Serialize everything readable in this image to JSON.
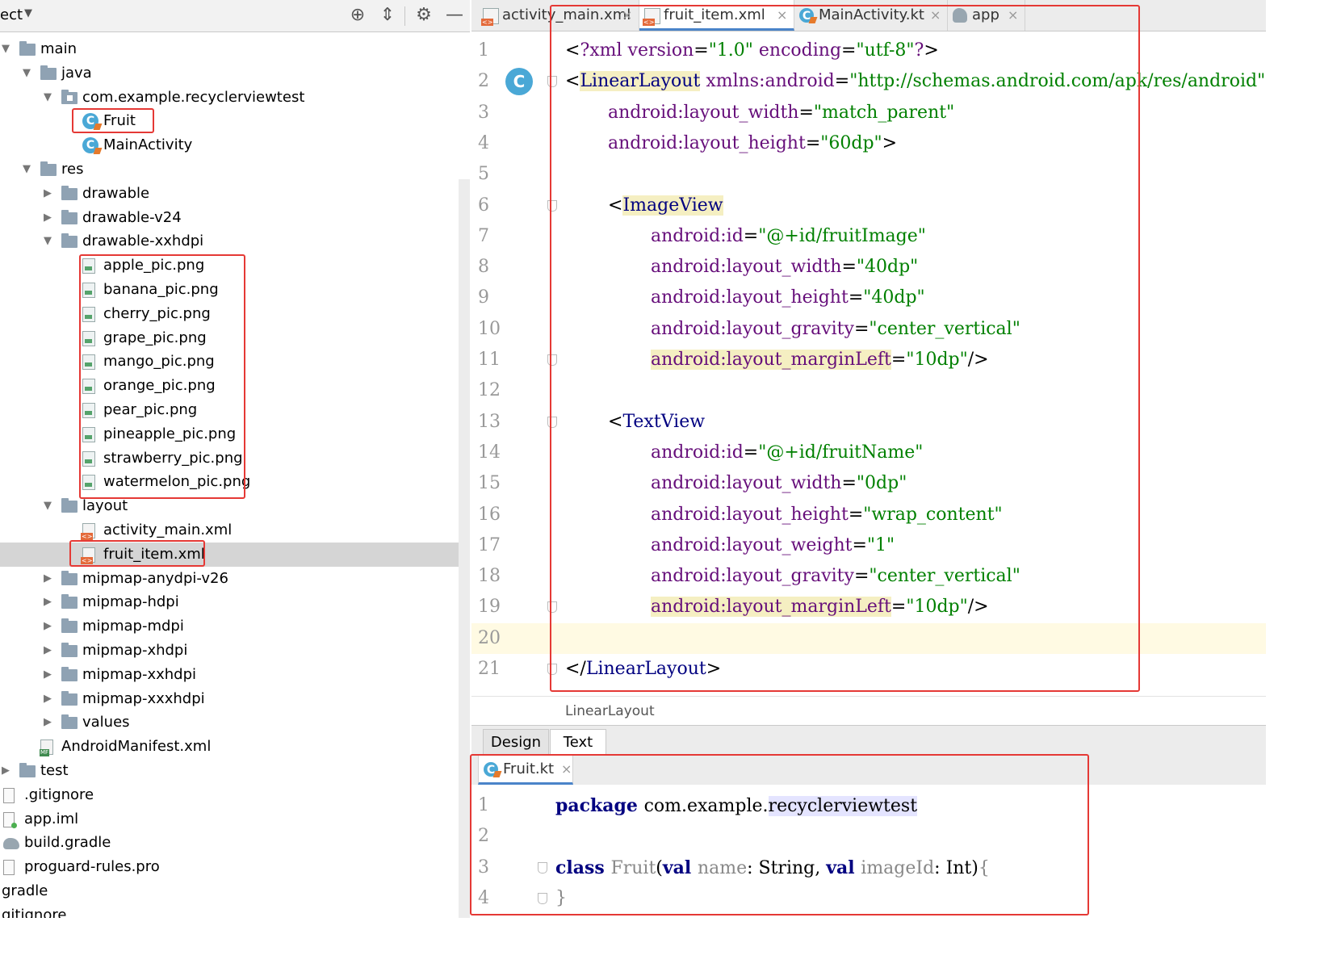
{
  "project_panel": {
    "title": "ect",
    "items": [
      {
        "label": "main",
        "type": "folder",
        "arrow": "down",
        "indent": 0
      },
      {
        "label": "java",
        "type": "folder",
        "arrow": "down",
        "indent": 1
      },
      {
        "label": "com.example.recyclerviewtest",
        "type": "package",
        "arrow": "down",
        "indent": 2
      },
      {
        "label": "Fruit",
        "type": "class",
        "arrow": "",
        "indent": 3
      },
      {
        "label": "MainActivity",
        "type": "class",
        "arrow": "",
        "indent": 3
      },
      {
        "label": "res",
        "type": "folder",
        "arrow": "down",
        "indent": 1
      },
      {
        "label": "drawable",
        "type": "folder",
        "arrow": "right",
        "indent": 2
      },
      {
        "label": "drawable-v24",
        "type": "folder",
        "arrow": "right",
        "indent": 2
      },
      {
        "label": "drawable-xxhdpi",
        "type": "folder",
        "arrow": "down",
        "indent": 2
      },
      {
        "label": "apple_pic.png",
        "type": "image",
        "arrow": "",
        "indent": 3
      },
      {
        "label": "banana_pic.png",
        "type": "image",
        "arrow": "",
        "indent": 3
      },
      {
        "label": "cherry_pic.png",
        "type": "image",
        "arrow": "",
        "indent": 3
      },
      {
        "label": "grape_pic.png",
        "type": "image",
        "arrow": "",
        "indent": 3
      },
      {
        "label": "mango_pic.png",
        "type": "image",
        "arrow": "",
        "indent": 3
      },
      {
        "label": "orange_pic.png",
        "type": "image",
        "arrow": "",
        "indent": 3
      },
      {
        "label": "pear_pic.png",
        "type": "image",
        "arrow": "",
        "indent": 3
      },
      {
        "label": "pineapple_pic.png",
        "type": "image",
        "arrow": "",
        "indent": 3
      },
      {
        "label": "strawberry_pic.png",
        "type": "image",
        "arrow": "",
        "indent": 3
      },
      {
        "label": "watermelon_pic.png",
        "type": "image",
        "arrow": "",
        "indent": 3
      },
      {
        "label": "layout",
        "type": "folder",
        "arrow": "down",
        "indent": 2
      },
      {
        "label": "activity_main.xml",
        "type": "xml",
        "arrow": "",
        "indent": 3
      },
      {
        "label": "fruit_item.xml",
        "type": "xml",
        "arrow": "",
        "indent": 3,
        "selected": true
      },
      {
        "label": "mipmap-anydpi-v26",
        "type": "folder",
        "arrow": "right",
        "indent": 2
      },
      {
        "label": "mipmap-hdpi",
        "type": "folder",
        "arrow": "right",
        "indent": 2
      },
      {
        "label": "mipmap-mdpi",
        "type": "folder",
        "arrow": "right",
        "indent": 2
      },
      {
        "label": "mipmap-xhdpi",
        "type": "folder",
        "arrow": "right",
        "indent": 2
      },
      {
        "label": "mipmap-xxhdpi",
        "type": "folder",
        "arrow": "right",
        "indent": 2
      },
      {
        "label": "mipmap-xxxhdpi",
        "type": "folder",
        "arrow": "right",
        "indent": 2
      },
      {
        "label": "values",
        "type": "folder",
        "arrow": "right",
        "indent": 2
      },
      {
        "label": "AndroidManifest.xml",
        "type": "manifest",
        "arrow": "",
        "indent": 1
      },
      {
        "label": "test",
        "type": "folder",
        "arrow": "right",
        "indent": 0
      },
      {
        "label": ".gitignore",
        "type": "text",
        "arrow": "",
        "indent": -1
      },
      {
        "label": "app.iml",
        "type": "iml",
        "arrow": "",
        "indent": -1
      },
      {
        "label": "build.gradle",
        "type": "gradle",
        "arrow": "",
        "indent": -1
      },
      {
        "label": "proguard-rules.pro",
        "type": "text",
        "arrow": "",
        "indent": -1
      },
      {
        "label": "gradle",
        "type": "none",
        "arrow": "",
        "indent": -2
      },
      {
        "label": "gitignore",
        "type": "none",
        "arrow": "",
        "indent": -2
      }
    ]
  },
  "editor_tabs": [
    {
      "label": "activity_main.xml",
      "icon": "xml-file-icon",
      "active": false
    },
    {
      "label": "fruit_item.xml",
      "icon": "xml-file-icon",
      "active": true
    },
    {
      "label": "MainActivity.kt",
      "icon": "kotlin-class-icon",
      "active": false
    },
    {
      "label": "app",
      "icon": "gradle-icon",
      "active": false
    }
  ],
  "close_glyph": "×",
  "gutter_badge": "C",
  "xml_lines": [
    {
      "n": "1",
      "indent": 0,
      "fold": false,
      "tokens": [
        [
          "pun",
          "<"
        ],
        [
          "attr",
          "?xml "
        ],
        [
          "attr",
          "version"
        ],
        [
          "pun",
          "="
        ],
        [
          "str",
          "\"1.0\" "
        ],
        [
          "attr",
          "encoding"
        ],
        [
          "pun",
          "="
        ],
        [
          "str",
          "\"utf-8\""
        ],
        [
          "attr",
          "?"
        ],
        [
          "pun",
          ">"
        ]
      ]
    },
    {
      "n": "2",
      "indent": 0,
      "fold": true,
      "tokens": [
        [
          "pun",
          "<"
        ],
        [
          "tag hl",
          "LinearLayout"
        ],
        [
          "pun",
          " "
        ],
        [
          "attr",
          "xmlns:android"
        ],
        [
          "pun",
          "="
        ],
        [
          "str",
          "\"http://schemas.android.com/apk/res/android\""
        ]
      ]
    },
    {
      "n": "3",
      "indent": 1,
      "fold": false,
      "tokens": [
        [
          "attr",
          "android:layout_width"
        ],
        [
          "pun",
          "="
        ],
        [
          "str",
          "\"match_parent\""
        ]
      ]
    },
    {
      "n": "4",
      "indent": 1,
      "fold": false,
      "tokens": [
        [
          "attr",
          "android:layout_height"
        ],
        [
          "pun",
          "="
        ],
        [
          "str",
          "\"60dp\""
        ],
        [
          "pun",
          ">"
        ]
      ]
    },
    {
      "n": "5",
      "indent": 0,
      "fold": false,
      "tokens": []
    },
    {
      "n": "6",
      "indent": 1,
      "fold": true,
      "tokens": [
        [
          "pun",
          "<"
        ],
        [
          "tag hl",
          "ImageView"
        ]
      ]
    },
    {
      "n": "7",
      "indent": 2,
      "fold": false,
      "tokens": [
        [
          "attr",
          "android:id"
        ],
        [
          "pun",
          "="
        ],
        [
          "str",
          "\"@+id/fruitImage\""
        ]
      ]
    },
    {
      "n": "8",
      "indent": 2,
      "fold": false,
      "tokens": [
        [
          "attr",
          "android:layout_width"
        ],
        [
          "pun",
          "="
        ],
        [
          "str",
          "\"40dp\""
        ]
      ]
    },
    {
      "n": "9",
      "indent": 2,
      "fold": false,
      "tokens": [
        [
          "attr",
          "android:layout_height"
        ],
        [
          "pun",
          "="
        ],
        [
          "str",
          "\"40dp\""
        ]
      ]
    },
    {
      "n": "10",
      "indent": 2,
      "fold": false,
      "tokens": [
        [
          "attr",
          "android:layout_gravity"
        ],
        [
          "pun",
          "="
        ],
        [
          "str",
          "\"center_vertical\""
        ]
      ]
    },
    {
      "n": "11",
      "indent": 2,
      "fold": true,
      "tokens": [
        [
          "attr hl",
          "android:layout_marginLeft"
        ],
        [
          "pun",
          "="
        ],
        [
          "str",
          "\"10dp\""
        ],
        [
          "pun",
          "/>"
        ]
      ]
    },
    {
      "n": "12",
      "indent": 0,
      "fold": false,
      "tokens": []
    },
    {
      "n": "13",
      "indent": 1,
      "fold": true,
      "tokens": [
        [
          "pun",
          "<"
        ],
        [
          "tag",
          "TextView"
        ]
      ]
    },
    {
      "n": "14",
      "indent": 2,
      "fold": false,
      "tokens": [
        [
          "attr",
          "android:id"
        ],
        [
          "pun",
          "="
        ],
        [
          "str",
          "\"@+id/fruitName\""
        ]
      ]
    },
    {
      "n": "15",
      "indent": 2,
      "fold": false,
      "tokens": [
        [
          "attr",
          "android:layout_width"
        ],
        [
          "pun",
          "="
        ],
        [
          "str",
          "\"0dp\""
        ]
      ]
    },
    {
      "n": "16",
      "indent": 2,
      "fold": false,
      "tokens": [
        [
          "attr",
          "android:layout_height"
        ],
        [
          "pun",
          "="
        ],
        [
          "str",
          "\"wrap_content\""
        ]
      ]
    },
    {
      "n": "17",
      "indent": 2,
      "fold": false,
      "tokens": [
        [
          "attr",
          "android:layout_weight"
        ],
        [
          "pun",
          "="
        ],
        [
          "str",
          "\"1\""
        ]
      ]
    },
    {
      "n": "18",
      "indent": 2,
      "fold": false,
      "tokens": [
        [
          "attr",
          "android:layout_gravity"
        ],
        [
          "pun",
          "="
        ],
        [
          "str",
          "\"center_vertical\""
        ]
      ]
    },
    {
      "n": "19",
      "indent": 2,
      "fold": true,
      "tokens": [
        [
          "attr hl",
          "android:layout_marginLeft"
        ],
        [
          "pun",
          "="
        ],
        [
          "str",
          "\"10dp\""
        ],
        [
          "pun",
          "/>"
        ]
      ]
    },
    {
      "n": "20",
      "indent": 0,
      "fold": false,
      "current": true,
      "tokens": []
    },
    {
      "n": "21",
      "indent": 0,
      "fold": true,
      "tokens": [
        [
          "pun",
          "</"
        ],
        [
          "tag",
          "LinearLayout"
        ],
        [
          "pun",
          ">"
        ]
      ]
    }
  ],
  "breadcrumb": "LinearLayout",
  "bottom_tabs": {
    "design": "Design",
    "text": "Text"
  },
  "kotlin_tab": {
    "label": "Fruit.kt"
  },
  "kotlin_lines": [
    {
      "n": "1",
      "fold": false,
      "tokens": [
        [
          "kw",
          "package "
        ],
        [
          "ident",
          "com.example."
        ],
        [
          "ident pkgpart",
          "recyclerviewtest"
        ]
      ]
    },
    {
      "n": "2",
      "fold": false,
      "tokens": []
    },
    {
      "n": "3",
      "fold": true,
      "tokens": [
        [
          "kw",
          "class "
        ],
        [
          "gray",
          "Fruit"
        ],
        [
          "ident",
          "("
        ],
        [
          "kw",
          "val "
        ],
        [
          "gray",
          "name"
        ],
        [
          "ident",
          ": String, "
        ],
        [
          "kw",
          "val "
        ],
        [
          "gray",
          "imageId"
        ],
        [
          "ident",
          ": Int)"
        ],
        [
          "gray",
          "{"
        ]
      ]
    },
    {
      "n": "4",
      "fold": true,
      "tokens": [
        [
          "gray",
          "}"
        ]
      ]
    }
  ],
  "colors": {
    "accent": "#4a84c9",
    "highlight_box": "#e53935",
    "class_icon": "#4aa8d6"
  }
}
